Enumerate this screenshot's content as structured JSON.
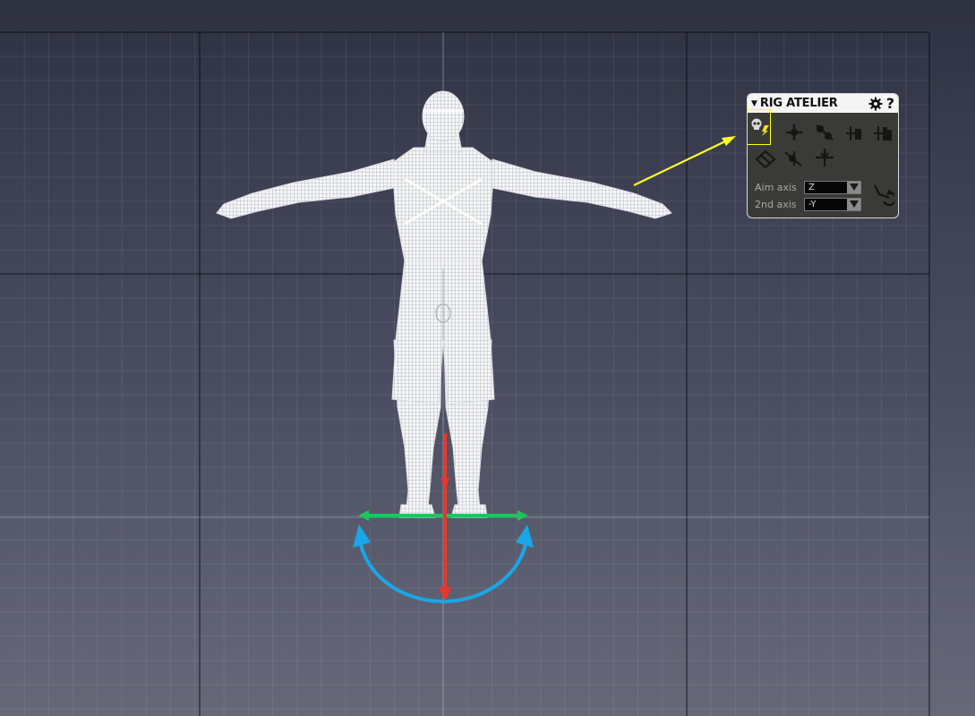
{
  "panel": {
    "title": "RIG ATELIER",
    "collapse_icon": "triangle-down-icon",
    "settings_icon": "gear-icon",
    "help_label": "?",
    "tools": [
      {
        "name": "skull-bolt-icon",
        "highlighted": true
      },
      {
        "name": "joint-tool-icon"
      },
      {
        "name": "bone-tool-icon"
      },
      {
        "name": "joint-chain-icon"
      },
      {
        "name": "joint-mirror-icon"
      },
      {
        "name": "locator-icon"
      },
      {
        "name": "orient-joint-icon"
      },
      {
        "name": "joint-move-icon"
      }
    ],
    "aim_axis": {
      "label": "Aim axis",
      "value": "Z"
    },
    "second_axis": {
      "label": "2nd axis",
      "value": "-Y"
    },
    "swap_icon": "swap-axis-icon"
  },
  "annotation": {
    "color": "#ffff22"
  },
  "gizmo": {
    "red": "#e8382a",
    "green": "#21c45a",
    "blue": "#1aa6e8"
  }
}
